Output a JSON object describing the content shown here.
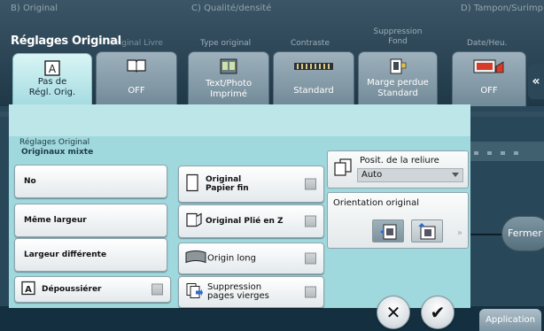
{
  "sections": {
    "original": "B)  Original",
    "quality": "C)  Qualité/densité",
    "stamp": "D)  Tampon/Surimp"
  },
  "original_section": {
    "title": "Réglages Original",
    "book_label": "Original Livre",
    "tabs": [
      {
        "label": "Pas de Régl. Orig.",
        "icon": "a-letter-icon",
        "active": true
      },
      {
        "label": "OFF",
        "icon": "book-icon",
        "active": false
      }
    ]
  },
  "quality_section": {
    "headers": [
      "Type original",
      "Contraste",
      "Suppression Fond"
    ],
    "tabs": [
      {
        "label": "Text/Photo Imprimé",
        "icon": "text-photo-icon"
      },
      {
        "label": "Standard",
        "icon": "contrast-icon"
      },
      {
        "label": "Marge perdue Standard",
        "icon": "background-removal-icon"
      }
    ]
  },
  "stamp_section": {
    "header": "Date/Heu.",
    "tab": {
      "label": "OFF",
      "icon": "date-stamp-icon"
    }
  },
  "collapse_label": "«",
  "fermer_label": "Fermer",
  "application_tab": "Application",
  "dialog": {
    "group_title": "Réglages Original",
    "group_subtitle": "Originaux mixte",
    "mixed_options": [
      {
        "label": "No"
      },
      {
        "label": "Même largeur"
      },
      {
        "label": "Largeur différente"
      }
    ],
    "options": [
      {
        "label_line1": "Original",
        "label_line2": "Papier fin",
        "icon": "thin-paper-icon"
      },
      {
        "label": "Original Plié en Z",
        "icon": "z-fold-icon"
      },
      {
        "label": "Origin long",
        "icon": "long-original-icon"
      },
      {
        "label_line1": "Suppression",
        "label_line2": "pages vierges",
        "icon": "blank-page-removal-icon"
      }
    ],
    "despeckle": {
      "label": "Dépoussiérer",
      "icon": "a-letter-icon"
    },
    "binding": {
      "title": "Posit. de la reliure",
      "value": "Auto"
    },
    "orientation": {
      "title": "Orientation original",
      "more": "»"
    },
    "cancel_symbol": "✕",
    "ok_symbol": "✔"
  }
}
